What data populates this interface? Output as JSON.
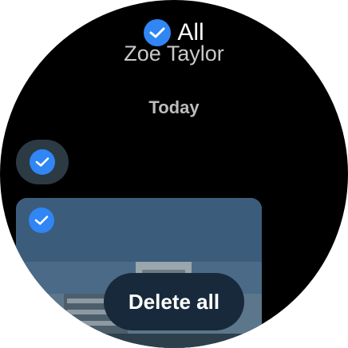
{
  "header": {
    "select_all_label": "All",
    "select_all_checked": true,
    "contact_name": "Zoe Taylor"
  },
  "conversation": {
    "date_label": "Today",
    "items": [
      {
        "kind": "message",
        "selected": true,
        "icon": "check-icon"
      },
      {
        "kind": "image",
        "selected": true,
        "icon": "check-icon"
      }
    ]
  },
  "actions": {
    "delete_all_label": "Delete all"
  },
  "colors": {
    "accent": "#2f86f4",
    "background": "#000000",
    "bubble": "#2c3a44",
    "button": "#17293a"
  }
}
